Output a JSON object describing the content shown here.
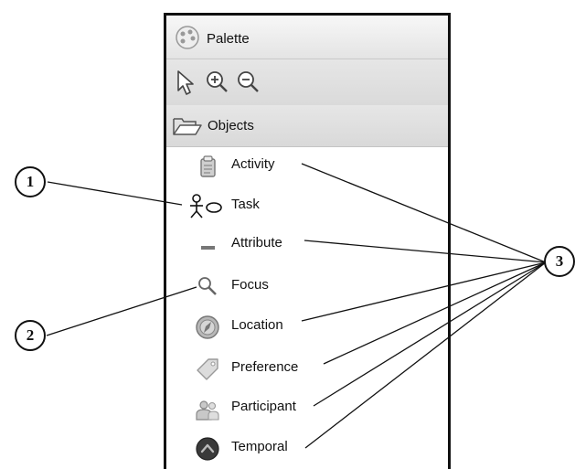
{
  "palette": {
    "title": "Palette",
    "icon": "palette-icon",
    "toolbar": {
      "tools": [
        {
          "name": "select-pointer-icon"
        },
        {
          "name": "zoom-in-icon"
        },
        {
          "name": "zoom-out-icon"
        }
      ]
    },
    "objects_drawer": {
      "title": "Objects",
      "icon": "folder-open-icon",
      "items": [
        {
          "label": "Activity",
          "icon": "clipboard-icon"
        },
        {
          "label": "Task",
          "icon": "task-icon"
        },
        {
          "label": "Attribute",
          "icon": "attribute-dash-icon"
        },
        {
          "label": "Focus",
          "icon": "magnifier-icon"
        },
        {
          "label": "Location",
          "icon": "compass-icon"
        },
        {
          "label": "Preference",
          "icon": "preference-tag-icon"
        },
        {
          "label": "Participant",
          "icon": "participants-icon"
        },
        {
          "label": "Temporal",
          "icon": "temporal-icon"
        }
      ]
    }
  },
  "callouts": {
    "one": "1",
    "two": "2",
    "three": "3"
  }
}
